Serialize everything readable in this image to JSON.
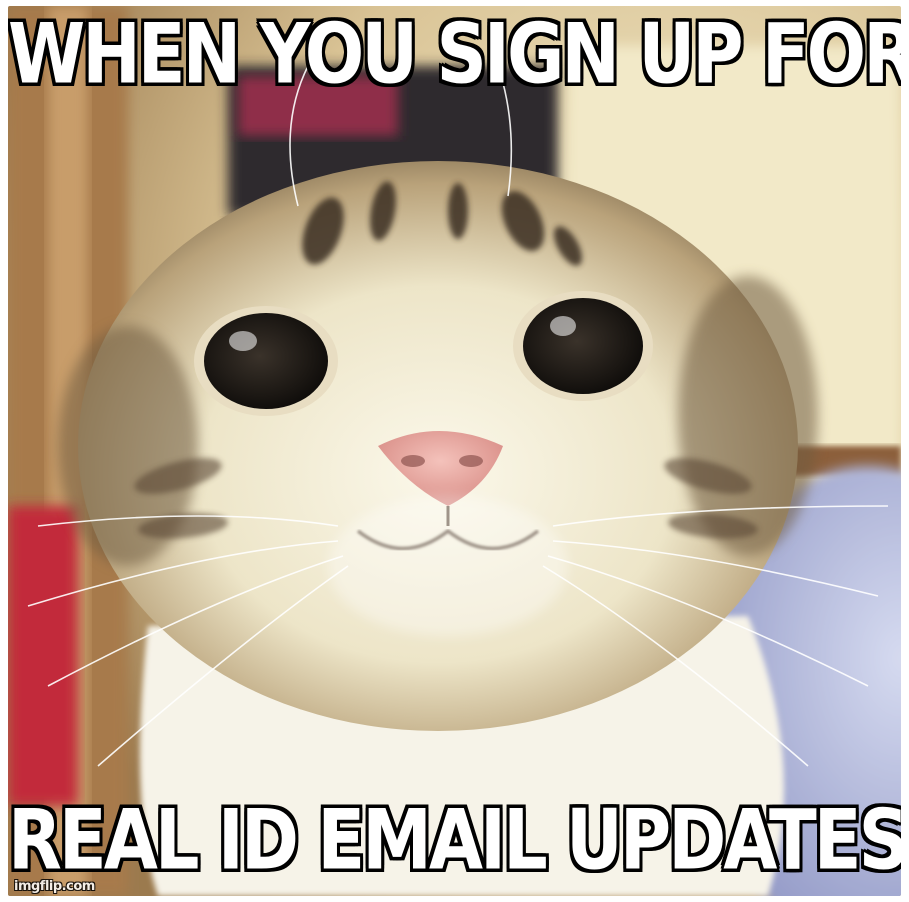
{
  "meme": {
    "top_text": "WHEN YOU SIGN UP FOR",
    "bottom_text": "REAL ID EMAIL UPDATES",
    "watermark": "imgflip.com"
  },
  "colors": {
    "caption_fill": "#ffffff",
    "caption_stroke": "#000000",
    "fur_light": "#f3f0de",
    "fur_tabby": "#a08a62",
    "eye_dark": "#1e1a16",
    "nose_pink": "#e9a9a2",
    "background_wall": "#efe4bd",
    "blanket_blue": "#b9bfe0",
    "background_red": "#c22a3a"
  },
  "image_subject": "smiling-cat-icon"
}
